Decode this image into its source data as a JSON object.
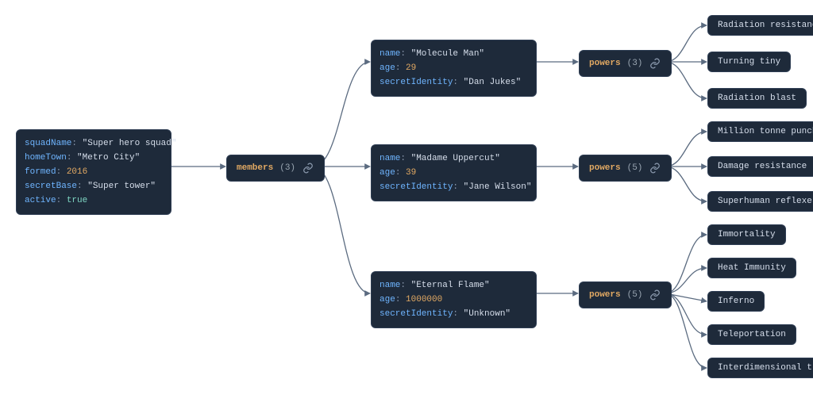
{
  "root": {
    "squadName": {
      "key": "squadName",
      "value": "\"Super hero squad\"",
      "type": "str"
    },
    "homeTown": {
      "key": "homeTown",
      "value": "\"Metro City\"",
      "type": "str"
    },
    "formed": {
      "key": "formed",
      "value": "2016",
      "type": "num"
    },
    "secretBase": {
      "key": "secretBase",
      "value": "\"Super tower\"",
      "type": "str"
    },
    "active": {
      "key": "active",
      "value": "true",
      "type": "bool"
    }
  },
  "membersNode": {
    "name": "members",
    "count": "(3)"
  },
  "members": [
    {
      "name": {
        "key": "name",
        "value": "\"Molecule Man\"",
        "type": "str"
      },
      "age": {
        "key": "age",
        "value": "29",
        "type": "num"
      },
      "secretIdentity": {
        "key": "secretIdentity",
        "value": "\"Dan Jukes\"",
        "type": "str"
      },
      "powersNode": {
        "name": "powers",
        "count": "(3)"
      },
      "powers": [
        "Radiation resistance",
        "Turning tiny",
        "Radiation blast"
      ]
    },
    {
      "name": {
        "key": "name",
        "value": "\"Madame Uppercut\"",
        "type": "str"
      },
      "age": {
        "key": "age",
        "value": "39",
        "type": "num"
      },
      "secretIdentity": {
        "key": "secretIdentity",
        "value": "\"Jane Wilson\"",
        "type": "str"
      },
      "powersNode": {
        "name": "powers",
        "count": "(5)"
      },
      "powers": [
        "Million tonne punch",
        "Damage resistance",
        "Superhuman reflexes"
      ]
    },
    {
      "name": {
        "key": "name",
        "value": "\"Eternal Flame\"",
        "type": "str"
      },
      "age": {
        "key": "age",
        "value": "1000000",
        "type": "num"
      },
      "secretIdentity": {
        "key": "secretIdentity",
        "value": "\"Unknown\"",
        "type": "str"
      },
      "powersNode": {
        "name": "powers",
        "count": "(5)"
      },
      "powers": [
        "Immortality",
        "Heat Immunity",
        "Inferno",
        "Teleportation",
        "Interdimensional travel"
      ]
    }
  ],
  "colors": {
    "nodeBg": "#1e2a3a",
    "nodeBorder": "#2f3e54",
    "connector": "#5b6b80",
    "key": "#6fb5ff",
    "string": "#d6deeb",
    "number": "#e2a963",
    "boolean": "#7fd7c4",
    "arrayName": "#e2a963",
    "count": "#9aa6b2"
  }
}
